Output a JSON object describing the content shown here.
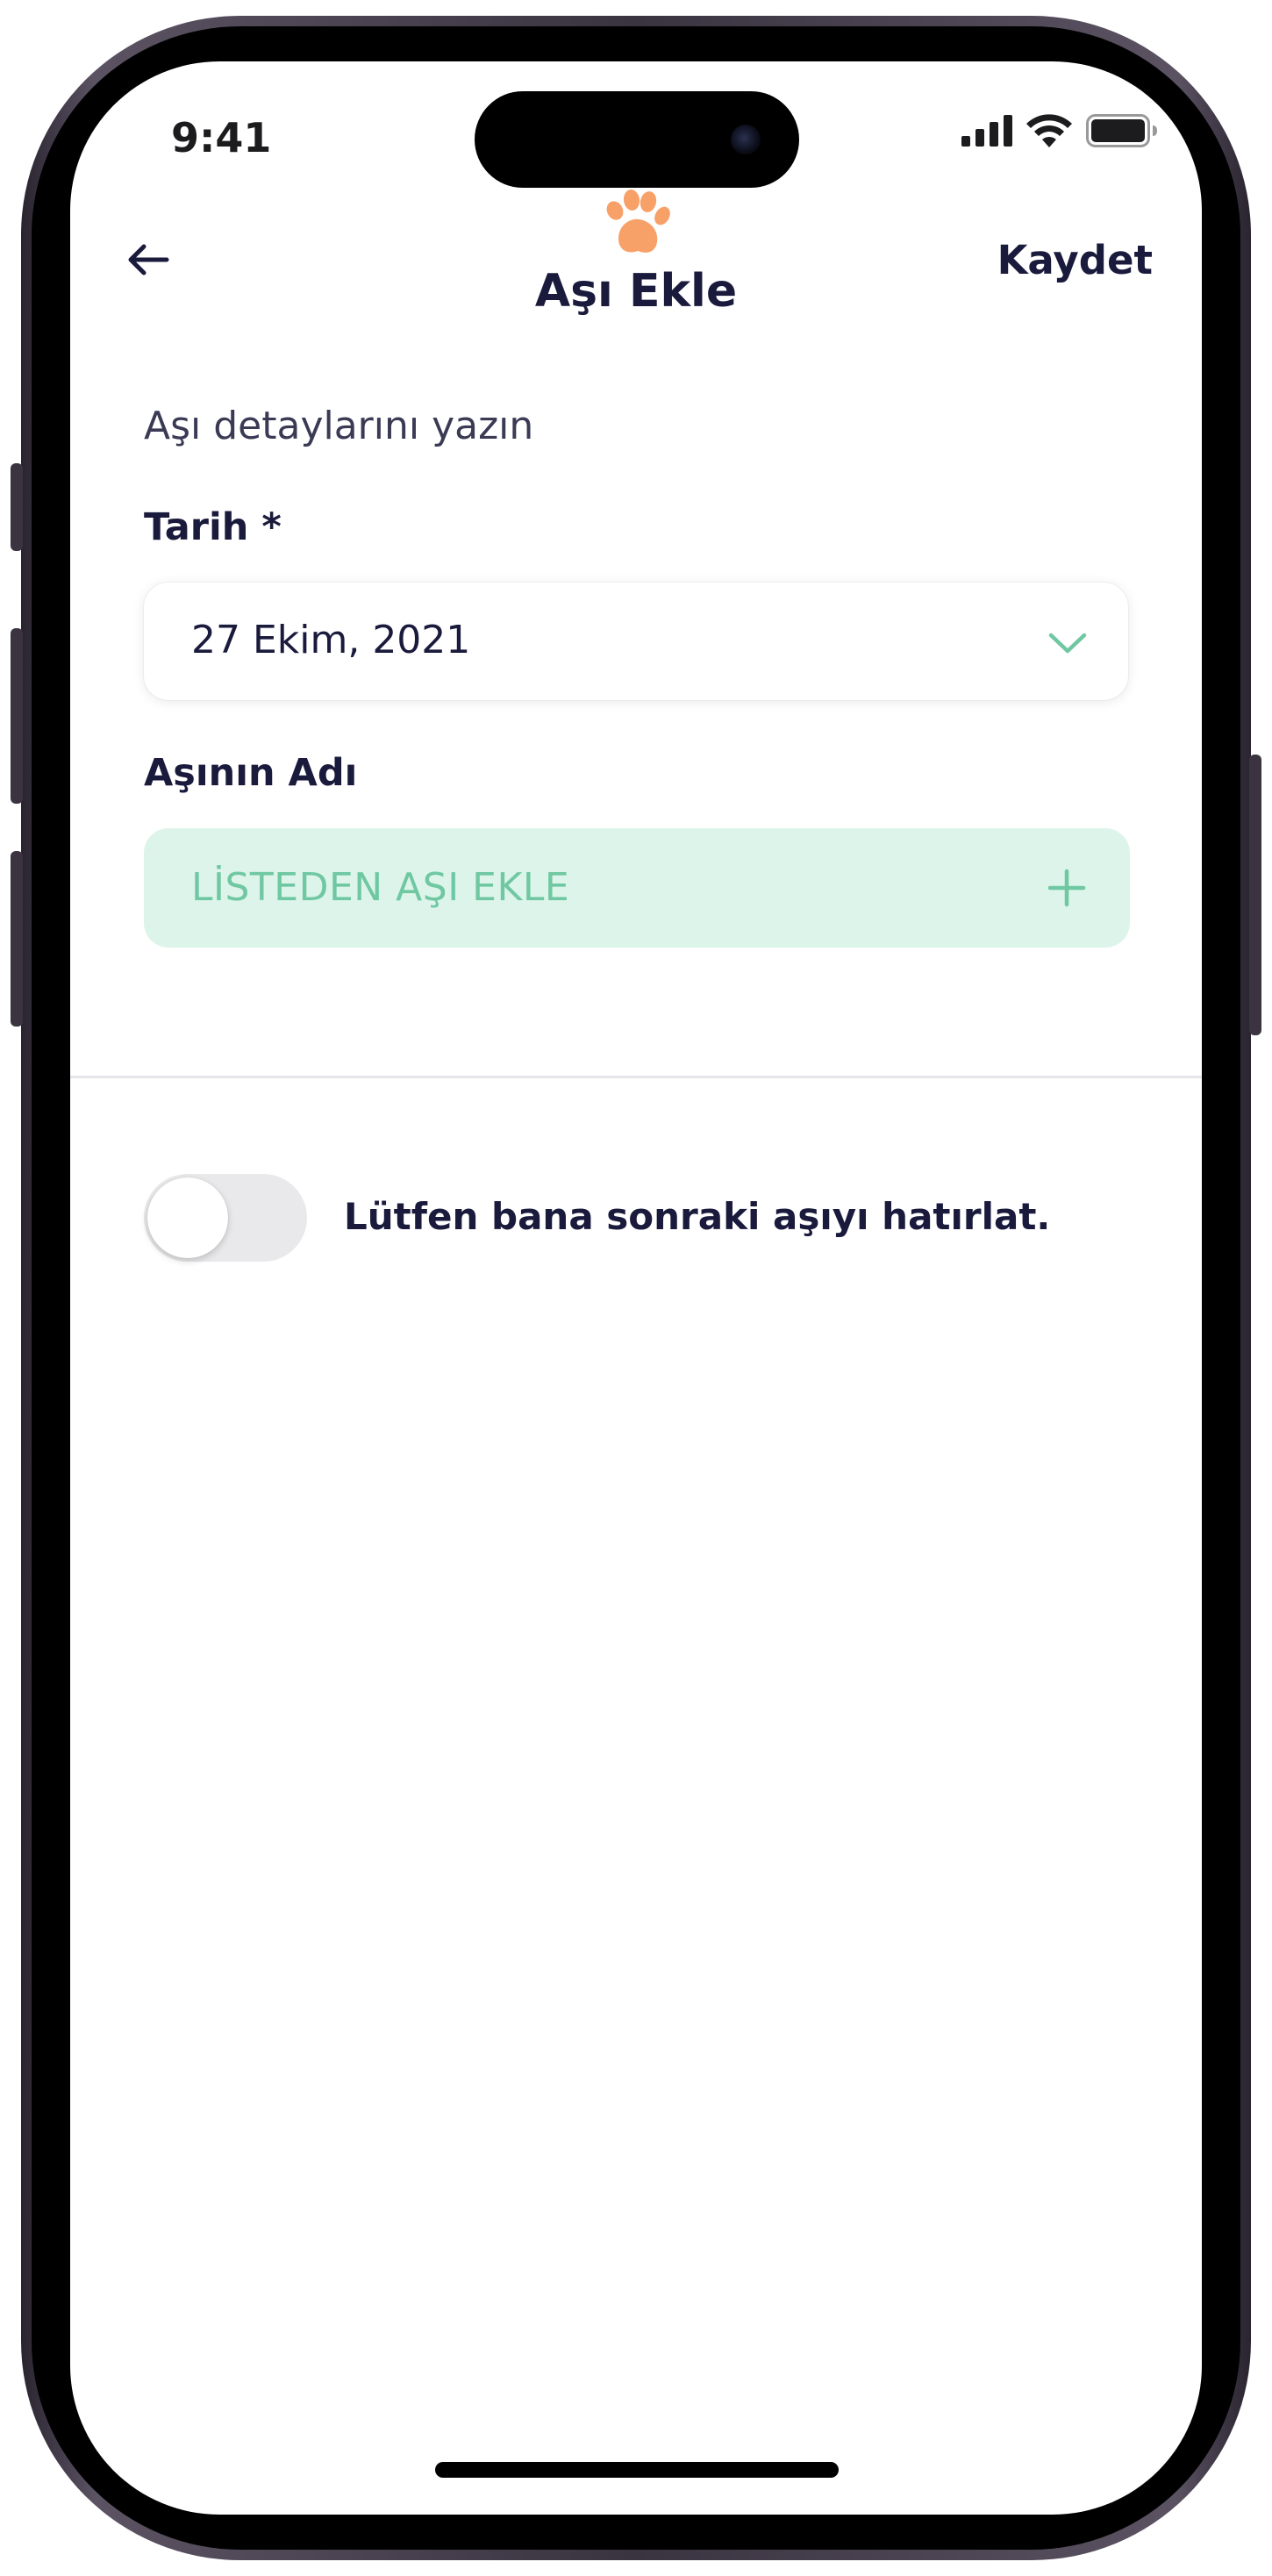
{
  "status_bar": {
    "time": "9:41",
    "icons": [
      "signal-icon",
      "wifi-icon",
      "battery-icon"
    ]
  },
  "nav": {
    "title": "Aşı Ekle",
    "save_label": "Kaydet",
    "back_icon": "arrow-left-icon",
    "logo_icon": "paw-icon"
  },
  "form": {
    "subtitle": "Aşı detaylarını yazın",
    "date_label": "Tarih *",
    "date_value": "27 Ekim, 2021",
    "name_label": "Aşının Adı",
    "add_from_list_label": "LİSTEDEN AŞI EKLE"
  },
  "reminder": {
    "label": "Lütfen bana sonraki aşıyı hatırlat.",
    "enabled": false
  },
  "colors": {
    "primary_text": "#1a1a3d",
    "accent_green": "#6fc8a2",
    "accent_green_bg": "#ddf4ea",
    "paw_orange": "#f7a169"
  }
}
